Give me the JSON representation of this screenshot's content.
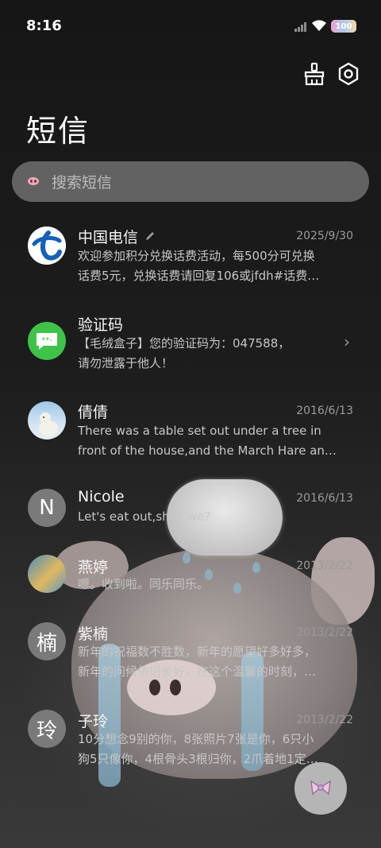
{
  "status_bar": {
    "time": "8:16",
    "battery": "100"
  },
  "header": {
    "title": "短信"
  },
  "search": {
    "placeholder": "搜索短信"
  },
  "conversations": [
    {
      "name": "中国电信",
      "date": "2025/9/30",
      "line1": "欢迎参加积分兑换话费活动，每500分可兑换",
      "line2": "话费5元，兑换话费请回复106或jfdh#话费…"
    },
    {
      "name": "验证码",
      "date": "",
      "line1": "【毛绒盒子】您的验证码为：047588，",
      "line2": "请勿泄露于他人！"
    },
    {
      "name": "倩倩",
      "date": "2016/6/13",
      "line1": "There was a table set out under a tree in",
      "line2": "front of the house,and the March Hare an…"
    },
    {
      "name": "Nicole",
      "date": "2016/6/13",
      "line1": "Let's eat out,shall we?",
      "line2": "",
      "avatar_text": "N"
    },
    {
      "name": "燕婷",
      "date": "2013/2/22",
      "line1": "嗯。收到啦。同乐同乐。",
      "line2": ""
    },
    {
      "name": "紫楠",
      "date": "2013/2/22",
      "line1": "新年的祝福数不胜数，新年的愿望好多好多，",
      "line2": "新年的问候依旧美好，在这个温馨的时刻，…",
      "avatar_text": "楠"
    },
    {
      "name": "子玲",
      "date": "2013/2/22",
      "line1": "10分想念9别的你，8张照片7张是你，6只小",
      "line2": "狗5只像你，4根骨头3根归你，2爪着地1定…",
      "avatar_text": "玲"
    }
  ],
  "colors": {
    "background": "#1b1b1b",
    "search_bg": "#626262",
    "verification_green": "#3fc24a",
    "telecom_blue": "#1560b8"
  },
  "icons": [
    "signal-icon",
    "wifi-icon",
    "battery-icon",
    "broom-icon",
    "settings-icon",
    "pig-search-icon",
    "chevron-right-icon",
    "compose-bow-icon"
  ]
}
